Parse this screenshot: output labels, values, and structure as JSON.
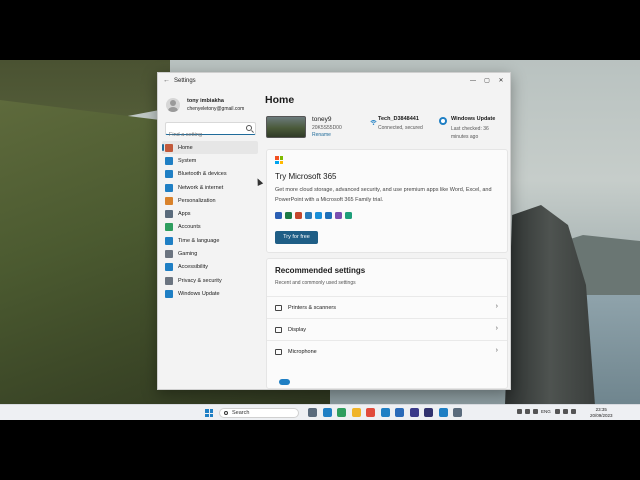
{
  "window": {
    "title": "Settings",
    "controls": {
      "minimize": "—",
      "maximize": "▢",
      "close": "✕"
    },
    "back": "←"
  },
  "user": {
    "name": "tony imbiakha",
    "email": "chenyeletony@gmail.com"
  },
  "search": {
    "placeholder": "Find a setting"
  },
  "nav": {
    "items": [
      {
        "label": "Home",
        "icon": "home-icon",
        "color": "#c25a3c"
      },
      {
        "label": "System",
        "icon": "system-icon",
        "color": "#1f7fc4"
      },
      {
        "label": "Bluetooth & devices",
        "icon": "bluetooth-icon",
        "color": "#1f7fc4"
      },
      {
        "label": "Network & internet",
        "icon": "network-icon",
        "color": "#1f7fc4"
      },
      {
        "label": "Personalization",
        "icon": "brush-icon",
        "color": "#d9822b"
      },
      {
        "label": "Apps",
        "icon": "apps-icon",
        "color": "#5a6b7c"
      },
      {
        "label": "Accounts",
        "icon": "accounts-icon",
        "color": "#2f9e5f"
      },
      {
        "label": "Time & language",
        "icon": "clock-icon",
        "color": "#1f7fc4"
      },
      {
        "label": "Gaming",
        "icon": "gaming-icon",
        "color": "#6b7480"
      },
      {
        "label": "Accessibility",
        "icon": "accessibility-icon",
        "color": "#1f7fc4"
      },
      {
        "label": "Privacy & security",
        "icon": "shield-icon",
        "color": "#6b7480"
      },
      {
        "label": "Windows Update",
        "icon": "update-icon",
        "color": "#1f7fc4"
      }
    ],
    "active_index": 0
  },
  "main": {
    "title": "Home",
    "device": {
      "name": "toney9",
      "model": "20K5S55D00",
      "rename": "Rename"
    },
    "wifi": {
      "name": "Tech_D3848441",
      "status": "Connected, secured"
    },
    "update": {
      "title": "Windows Update",
      "status": "Last checked: 36 minutes ago"
    },
    "promo": {
      "title": "Try Microsoft 365",
      "description": "Get more cloud storage, advanced security, and use premium apps like Word, Excel, and PowerPoint with a Microsoft 365 Family trial.",
      "button": "Try for free",
      "app_colors": [
        "#2b5fb4",
        "#1d7a45",
        "#c4472c",
        "#2a7ab8",
        "#1a8fd8",
        "#1f6fb8",
        "#7a4fb0",
        "#1e9e7a"
      ]
    },
    "recommended": {
      "title": "Recommended settings",
      "subtitle": "Recent and commonly used settings",
      "items": [
        {
          "label": "Printers & scanners",
          "icon": "printer-icon"
        },
        {
          "label": "Display",
          "icon": "display-icon"
        },
        {
          "label": "Microphone",
          "icon": "microphone-icon"
        }
      ]
    }
  },
  "taskbar": {
    "search_label": "Search",
    "lang": "ENG",
    "time": "23:35",
    "date": "20/09/2023",
    "app_colors": [
      "#5a6b7c",
      "#1f7fc4",
      "#2f9e5f",
      "#f0b429",
      "#e14b3b",
      "#1f7fc4",
      "#2a6ab8",
      "#3a3a8a",
      "#31326e",
      "#1f7fc4",
      "#5a6b7c"
    ]
  }
}
